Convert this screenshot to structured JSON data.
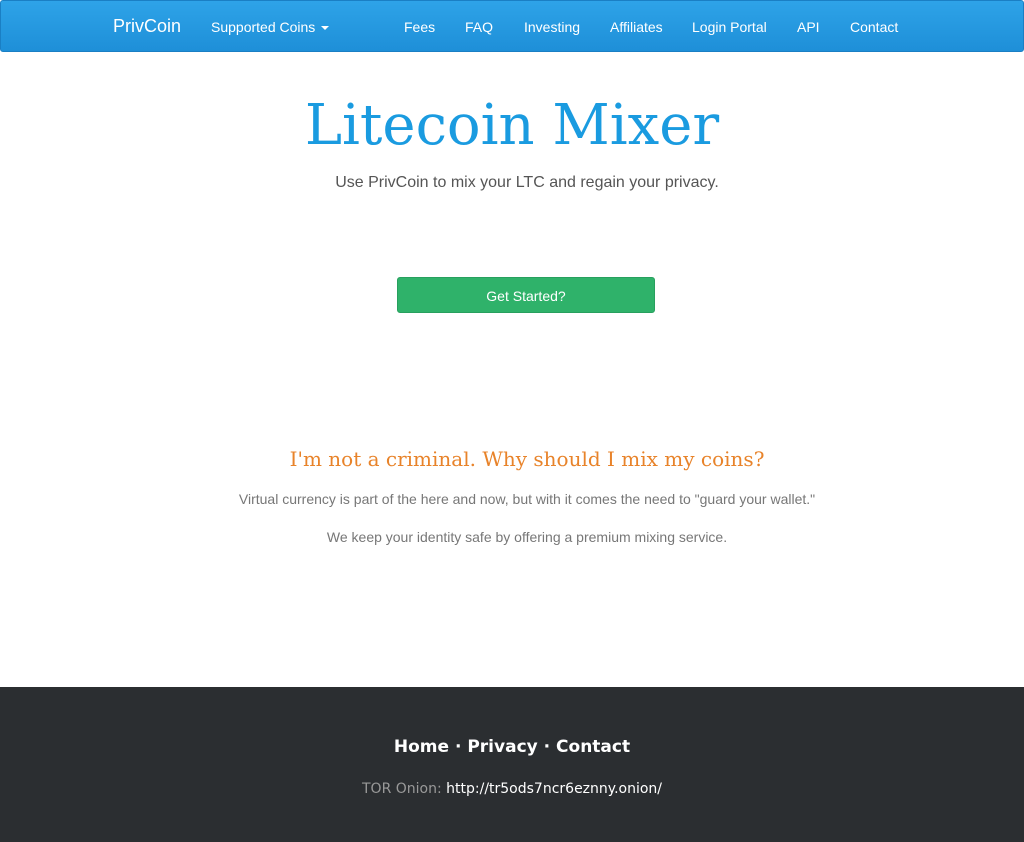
{
  "navbar": {
    "brand": "PrivCoin",
    "items": [
      {
        "label": "Supported Coins",
        "has_dropdown": true
      },
      {
        "label": "Fees"
      },
      {
        "label": "FAQ"
      },
      {
        "label": "Investing"
      },
      {
        "label": "Affiliates"
      },
      {
        "label": "Login Portal"
      },
      {
        "label": "API"
      },
      {
        "label": "Contact"
      }
    ]
  },
  "hero": {
    "title": "Litecoin Mixer",
    "subtitle": "Use PrivCoin to mix your LTC and regain your privacy.",
    "cta_label": "Get Started?"
  },
  "why": {
    "heading": "I'm not a criminal. Why should I mix my coins?",
    "paragraphs": [
      "Virtual currency is part of the here and now, but with it comes the need to \"guard your wallet.\"",
      "We keep your identity safe by offering a premium mixing service."
    ]
  },
  "footer": {
    "links": [
      "Home",
      "Privacy",
      "Contact"
    ],
    "separator": "·",
    "tor_label": "TOR Onion:",
    "tor_url": "http://tr5ods7ncr6eznny.onion/"
  },
  "colors": {
    "navbar": "#1e8fd8",
    "title": "#1a9be0",
    "cta": "#2fb26a",
    "heading_accent": "#e8832a",
    "footer_bg": "#2b2e31"
  }
}
